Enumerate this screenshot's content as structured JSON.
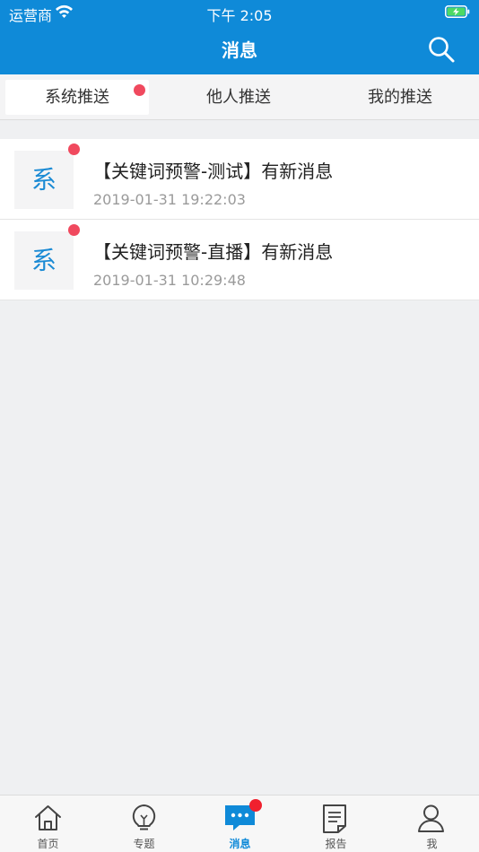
{
  "status_bar": {
    "carrier": "运营商",
    "time": "下午 2:05"
  },
  "nav": {
    "title": "消息",
    "search_icon": "search-icon"
  },
  "tabs": [
    {
      "label": "系统推送",
      "active": true,
      "badge": true
    },
    {
      "label": "他人推送",
      "active": false,
      "badge": false
    },
    {
      "label": "我的推送",
      "active": false,
      "badge": false
    }
  ],
  "messages": [
    {
      "avatar": "系",
      "title": "【关键词预警-测试】有新消息",
      "time": "2019-01-31 19:22:03",
      "unread": true
    },
    {
      "avatar": "系",
      "title": "【关键词预警-直播】有新消息",
      "time": "2019-01-31 10:29:48",
      "unread": true
    }
  ],
  "tabbar": [
    {
      "label": "首页",
      "icon": "home-icon",
      "active": false
    },
    {
      "label": "专题",
      "icon": "lightbulb-icon",
      "active": false
    },
    {
      "label": "消息",
      "icon": "message-icon",
      "active": true,
      "badge": true
    },
    {
      "label": "报告",
      "icon": "report-icon",
      "active": false
    },
    {
      "label": "我",
      "icon": "user-icon",
      "active": false
    }
  ],
  "colors": {
    "primary": "#0f8ad8",
    "badge": "#f0495e"
  }
}
